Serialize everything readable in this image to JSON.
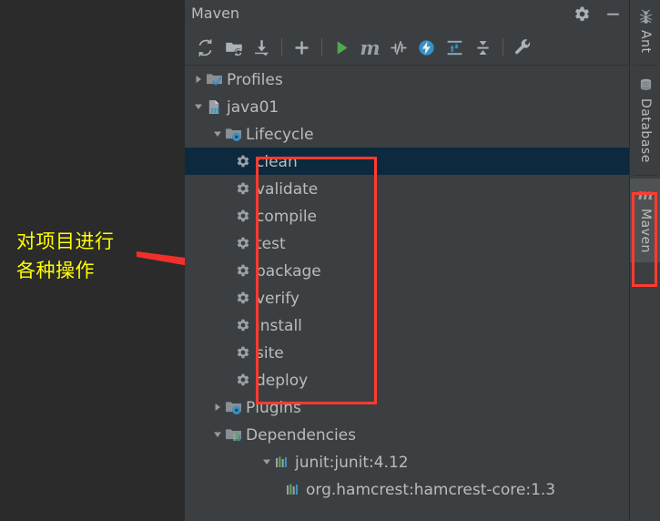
{
  "annotation": {
    "text": "对项目进行\n各种操作",
    "text_color": "#ffff00",
    "arrow_color": "#ff3b30",
    "box_color": "#ff3b30"
  },
  "window": {
    "title": "Maven",
    "settings_label": "Settings",
    "minimize_label": "Hide",
    "toolbar": [
      {
        "name": "reimport-all-maven-projects",
        "tip": "Reimport All Maven Projects"
      },
      {
        "name": "generate-sources-and-update-folders",
        "tip": "Generate Sources and Update Folders For All Projects"
      },
      {
        "name": "download-sources-and-documentation",
        "tip": "Download Sources and/or Documentation"
      },
      {
        "name": "add-maven-project",
        "tip": "Add Maven Projects"
      },
      {
        "name": "run-maven-build",
        "tip": "Run Maven Build"
      },
      {
        "name": "execute-maven-goal",
        "tip": "Execute Maven Goal"
      },
      {
        "name": "toggle-skip-tests",
        "tip": "Toggle 'Skip Tests' Mode"
      },
      {
        "name": "toggle-offline-mode",
        "tip": "Toggle Offline Mode"
      },
      {
        "name": "expand-all",
        "tip": "Expand All"
      },
      {
        "name": "collapse-all",
        "tip": "Collapse All"
      },
      {
        "name": "maven-settings",
        "tip": "Maven Settings"
      }
    ]
  },
  "tree": {
    "profiles": {
      "label": "Profiles",
      "expanded": false
    },
    "project": {
      "label": "java01",
      "expanded": true
    },
    "lifecycle": {
      "label": "Lifecycle",
      "expanded": true,
      "goals": [
        {
          "label": "clean",
          "selected": true
        },
        {
          "label": "validate",
          "selected": false
        },
        {
          "label": "compile",
          "selected": false
        },
        {
          "label": "test",
          "selected": false
        },
        {
          "label": "package",
          "selected": false
        },
        {
          "label": "verify",
          "selected": false
        },
        {
          "label": "install",
          "selected": false
        },
        {
          "label": "site",
          "selected": false
        },
        {
          "label": "deploy",
          "selected": false
        }
      ]
    },
    "plugins": {
      "label": "Plugins",
      "expanded": false
    },
    "dependencies": {
      "label": "Dependencies",
      "expanded": true,
      "items": [
        {
          "label": "junit:junit:4.12",
          "expanded": true
        },
        {
          "label": "org.hamcrest:hamcrest-core:1.3",
          "expanded": false
        }
      ]
    }
  },
  "rail": {
    "tabs": [
      {
        "label": "Ant",
        "icon": "ant-icon",
        "active": false
      },
      {
        "label": "Database",
        "icon": "database-icon",
        "active": false
      },
      {
        "label": "Maven",
        "icon": "maven-m-icon",
        "active": true
      }
    ]
  },
  "colors": {
    "panel_bg": "#3c3f41",
    "canvas_bg": "#2b2b2b",
    "selection_bg": "#0d293e",
    "text": "#bbbbbb",
    "accent_blue": "#3592c4",
    "accent_green": "#59a869"
  }
}
